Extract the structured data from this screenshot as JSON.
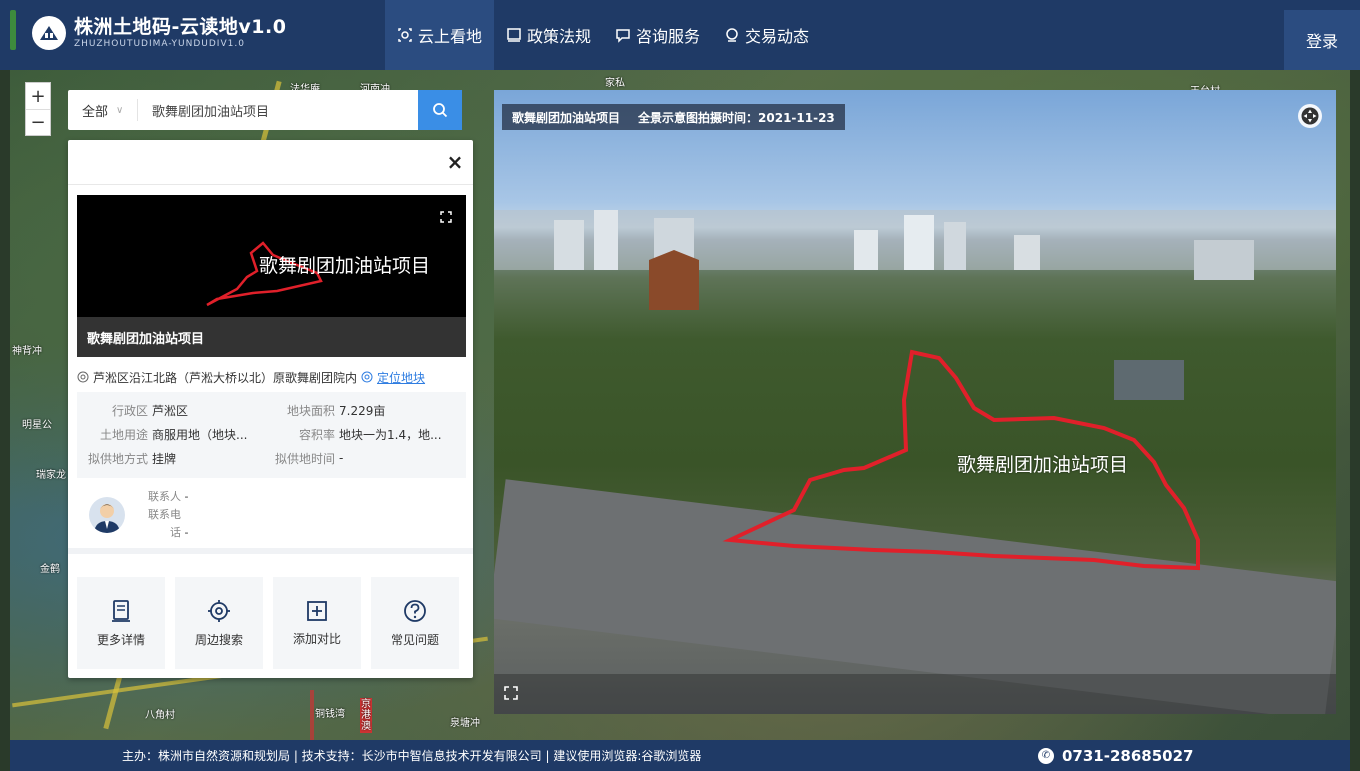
{
  "header": {
    "logo_title": "株洲土地码-云读地v1.0",
    "logo_subtitle": "ZHUZHOUTUDIMA-YUNDUDIV1.0",
    "nav": [
      {
        "label": "云上看地",
        "icon": "panorama-icon",
        "active": true
      },
      {
        "label": "政策法规",
        "icon": "document-icon",
        "active": false
      },
      {
        "label": "咨询服务",
        "icon": "chat-icon",
        "active": false
      },
      {
        "label": "交易动态",
        "icon": "transaction-icon",
        "active": false
      }
    ],
    "login_label": "登录"
  },
  "map": {
    "zoom_in": "+",
    "zoom_out": "−",
    "labels": [
      "法华庵",
      "河南冲",
      "家私",
      "王台村",
      "神背冲",
      "明星公",
      "瑞家龙",
      "金鹤",
      "八角村",
      "铜钱湾",
      "京港澳",
      "泉塘冲"
    ]
  },
  "search": {
    "scope": "全部",
    "value": "歌舞剧团加油站项目"
  },
  "panel": {
    "close_label": "×",
    "thumb_label": "歌舞剧团加油站项目",
    "thumb_title": "歌舞剧团加油站项目",
    "address": "芦淞区沿江北路（芦淞大桥以北）原歌舞剧团院内",
    "locate_label": "定位地块",
    "info": {
      "district_k": "行政区",
      "district_v": "芦淞区",
      "area_k": "地块面积",
      "area_v": "7.229亩",
      "use_k": "土地用途",
      "use_v": "商服用地（地块...",
      "far_k": "容积率",
      "far_v": "地块一为1.4，地...",
      "supply_k": "拟供地方式",
      "supply_v": "挂牌",
      "time_k": "拟供地时间",
      "time_v": "-"
    },
    "contact": {
      "person_k": "联系人",
      "person_v": "-",
      "phone_k": "联系电话",
      "phone_v": "-"
    },
    "actions": [
      {
        "label": "更多详情",
        "icon": "details-icon"
      },
      {
        "label": "周边搜索",
        "icon": "nearby-search-icon"
      },
      {
        "label": "添加对比",
        "icon": "add-compare-icon"
      },
      {
        "label": "常见问题",
        "icon": "faq-icon"
      }
    ]
  },
  "panorama": {
    "project": "歌舞剧团加油站项目",
    "capture_time": "全景示意图拍摄时间：2021-11-23",
    "label": "歌舞剧团加油站项目"
  },
  "footer": {
    "text": "主办：株洲市自然资源和规划局  |  技术支持：长沙市中智信息技术开发有限公司 |  建议使用浏览器:谷歌浏览器",
    "phone": "0731-28685027"
  },
  "colors": {
    "header_bg": "#1f3a66",
    "accent": "#3a8ee6",
    "boundary": "#e0202a"
  }
}
